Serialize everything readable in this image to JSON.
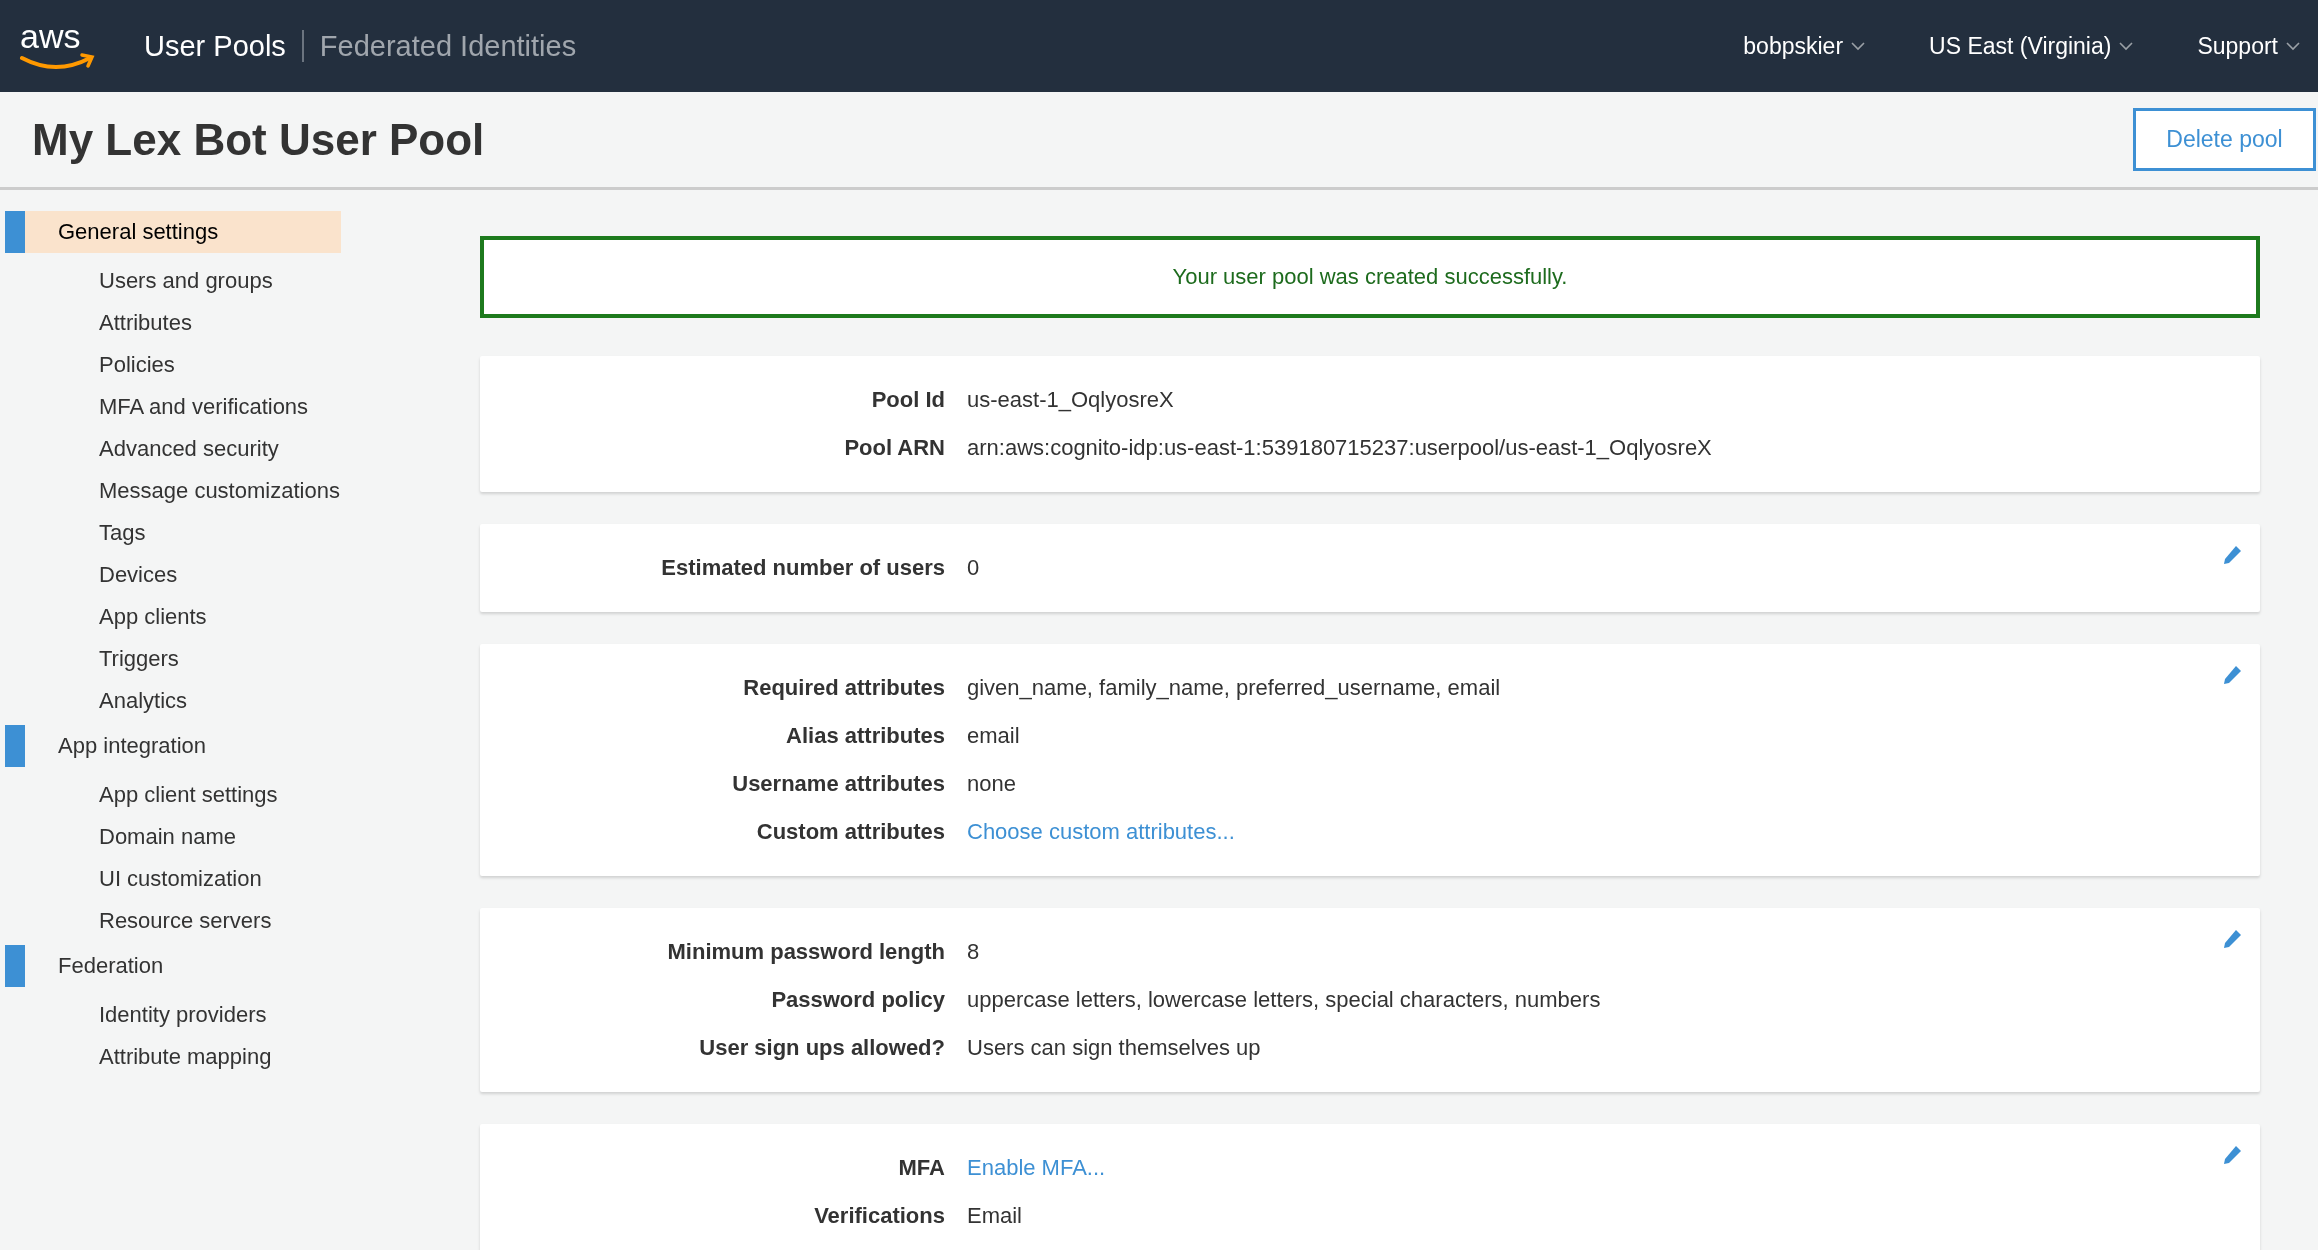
{
  "navbar": {
    "logo": "aws",
    "sections": [
      {
        "label": "User Pools",
        "selected": true
      },
      {
        "label": "Federated Identities",
        "selected": false
      }
    ],
    "menus": [
      {
        "label": "bobpskier"
      },
      {
        "label": "US East (Virginia)"
      },
      {
        "label": "Support"
      }
    ]
  },
  "header": {
    "title": "My Lex Bot User Pool",
    "button": "Delete pool"
  },
  "sidebar": {
    "groups": [
      {
        "label": "General settings",
        "selected": true,
        "children": [
          {
            "label": "Users and groups",
            "selected": false
          },
          {
            "label": "Attributes",
            "selected": false
          },
          {
            "label": "Policies",
            "selected": false
          },
          {
            "label": "MFA and verifications",
            "selected": false
          },
          {
            "label": "Advanced security",
            "selected": false
          },
          {
            "label": "Message customizations",
            "selected": false
          },
          {
            "label": "Tags",
            "selected": false
          },
          {
            "label": "Devices",
            "selected": false
          },
          {
            "label": "App clients",
            "selected": false
          },
          {
            "label": "Triggers",
            "selected": false
          },
          {
            "label": "Analytics",
            "selected": false
          }
        ]
      },
      {
        "label": "App integration",
        "selected": false,
        "children": [
          {
            "label": "App client settings",
            "selected": false
          },
          {
            "label": "Domain name",
            "selected": false
          },
          {
            "label": "UI customization",
            "selected": false
          },
          {
            "label": "Resource servers",
            "selected": false
          }
        ]
      },
      {
        "label": "Federation",
        "selected": false,
        "children": [
          {
            "label": "Identity providers",
            "selected": false
          },
          {
            "label": "Attribute mapping",
            "selected": false
          }
        ]
      }
    ]
  },
  "alert": {
    "message": "Your user pool was created successfully."
  },
  "cards": [
    {
      "editable": false,
      "rows": [
        {
          "label": "Pool Id",
          "value": "us-east-1_OqlyosreX",
          "kind": "text"
        },
        {
          "label": "Pool ARN",
          "value": "arn:aws:cognito-idp:us-east-1:539180715237:userpool/us-east-1_OqlyosreX",
          "kind": "text"
        }
      ]
    },
    {
      "editable": true,
      "rows": [
        {
          "label": "Estimated number of users",
          "value": "0",
          "kind": "text"
        }
      ]
    },
    {
      "editable": true,
      "rows": [
        {
          "label": "Required attributes",
          "value": "given_name, family_name, preferred_username, email",
          "kind": "text"
        },
        {
          "label": "Alias attributes",
          "value": "email",
          "kind": "text"
        },
        {
          "label": "Username attributes",
          "value": "none",
          "kind": "text"
        },
        {
          "label": "Custom attributes",
          "value": "Choose custom attributes...",
          "kind": "link"
        }
      ]
    },
    {
      "editable": true,
      "rows": [
        {
          "label": "Minimum password length",
          "value": "8",
          "kind": "text"
        },
        {
          "label": "Password policy",
          "value": "uppercase letters, lowercase letters, special characters, numbers",
          "kind": "text"
        },
        {
          "label": "User sign ups allowed?",
          "value": "Users can sign themselves up",
          "kind": "text"
        }
      ]
    },
    {
      "editable": true,
      "rows": [
        {
          "label": "MFA",
          "value": "Enable MFA...",
          "kind": "link"
        },
        {
          "label": "Verifications",
          "value": "Email",
          "kind": "text"
        }
      ]
    }
  ]
}
